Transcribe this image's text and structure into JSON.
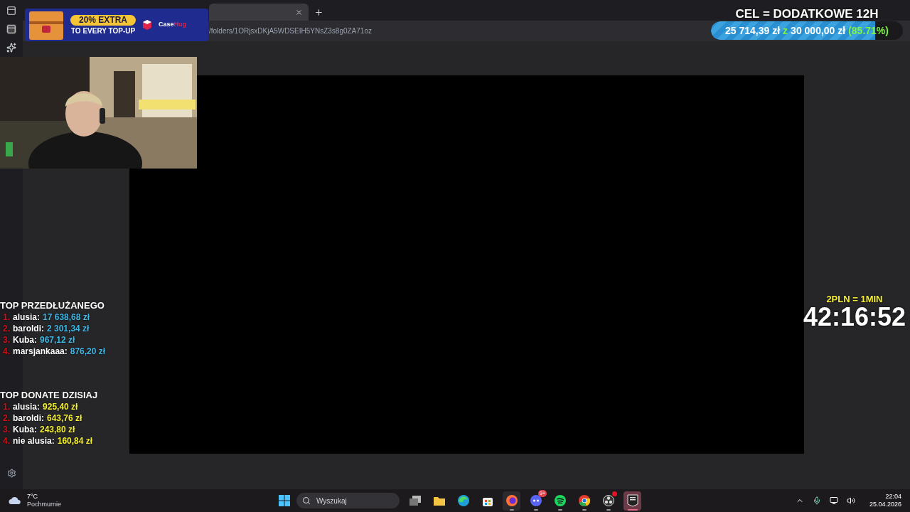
{
  "browser": {
    "tabs": [
      {
        "selected": true
      }
    ],
    "url": "/folders/1ORjsxDKjA5WDSEIH5YNsZ3s8g0ZA71oz"
  },
  "ad": {
    "headline": "20% EXTRA",
    "subline": "TO EVERY TOP-UP",
    "brand": "Case",
    "brand_accent": "Hug"
  },
  "goal": {
    "title": "CEL = DODATKOWE 12H",
    "raised": "25 714,39 zł",
    "separator": "z",
    "target": "30 000,00 zł",
    "percent": "(85.71%)",
    "level": 0.857
  },
  "timer": {
    "rate": "2PLN = 1MIN",
    "time": "42:16:52"
  },
  "boards": [
    {
      "title": "TOP PRZEDŁUŻANEGO",
      "color": "#3fb8e6",
      "entries": [
        {
          "rank": "1.",
          "name": "alusia:",
          "amount": "17 638,68 zł"
        },
        {
          "rank": "2.",
          "name": "baroldi:",
          "amount": "2 301,34 zł"
        },
        {
          "rank": "3.",
          "name": "Kuba:",
          "amount": "967,12 zł"
        },
        {
          "rank": "4.",
          "name": "marsjankaaa:",
          "amount": "876,20 zł"
        }
      ]
    },
    {
      "title": "TOP DONATE DZISIAJ",
      "color": "#f5f032",
      "entries": [
        {
          "rank": "1.",
          "name": "alusia:",
          "amount": "925,40 zł"
        },
        {
          "rank": "2.",
          "name": "baroldi:",
          "amount": "643,76 zł"
        },
        {
          "rank": "3.",
          "name": "Kuba:",
          "amount": "243,80 zł"
        },
        {
          "rank": "4.",
          "name": "nie alusia:",
          "amount": "160,84 zł"
        }
      ]
    }
  ],
  "taskbar": {
    "weather": {
      "temp": "7°C",
      "condition": "Pochmurnie"
    },
    "search": {
      "placeholder": "Wyszukaj"
    },
    "apps": [
      {
        "kind": "taskview",
        "running": false,
        "selected": false
      },
      {
        "kind": "folder",
        "running": false,
        "selected": false
      },
      {
        "kind": "edge",
        "running": false,
        "selected": false
      },
      {
        "kind": "store",
        "running": false,
        "selected": false
      },
      {
        "kind": "firefox",
        "running": true,
        "selected": false
      },
      {
        "kind": "discord",
        "running": true,
        "selected": false,
        "badge": "9+"
      },
      {
        "kind": "spotify",
        "running": true,
        "selected": false
      },
      {
        "kind": "chrome",
        "running": true,
        "selected": false
      },
      {
        "kind": "obs",
        "running": true,
        "selected": false,
        "alert": true
      },
      {
        "kind": "epic",
        "running": true,
        "selected": true
      }
    ],
    "clock": {
      "time": "22:04",
      "date": "25.04.2026"
    }
  }
}
